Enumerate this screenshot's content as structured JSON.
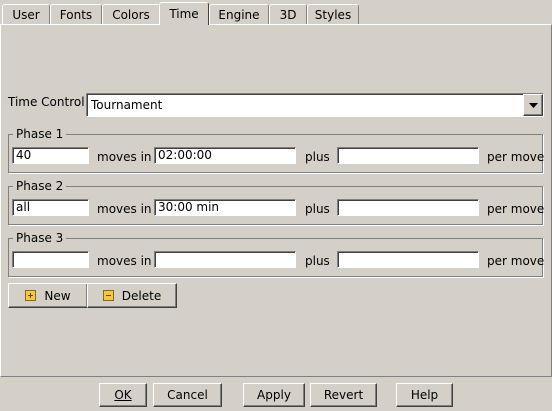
{
  "tabs": [
    {
      "label": "User",
      "active": false
    },
    {
      "label": "Fonts",
      "active": false
    },
    {
      "label": "Colors",
      "active": false
    },
    {
      "label": "Time",
      "active": true
    },
    {
      "label": "Engine",
      "active": false
    },
    {
      "label": "3D",
      "active": false
    },
    {
      "label": "Styles",
      "active": false
    }
  ],
  "time_control": {
    "label": "Time Control",
    "value": "Tournament"
  },
  "phases": [
    {
      "title": "Phase 1",
      "moves": "40",
      "moves_label": "moves in",
      "time": "02:00:00",
      "plus_label": "plus",
      "increment": "",
      "per_move_label": "per move"
    },
    {
      "title": "Phase 2",
      "moves": "all",
      "moves_label": "moves in",
      "time": "30:00 min",
      "plus_label": "plus",
      "increment": "",
      "per_move_label": "per move"
    },
    {
      "title": "Phase 3",
      "moves": "",
      "moves_label": "moves in",
      "time": "",
      "plus_label": "plus",
      "increment": "",
      "per_move_label": "per move"
    }
  ],
  "phase_buttons": {
    "new_label": "New",
    "delete_label": "Delete"
  },
  "dialog_buttons": {
    "ok": "OK",
    "cancel": "Cancel",
    "apply": "Apply",
    "revert": "Revert",
    "help": "Help"
  }
}
